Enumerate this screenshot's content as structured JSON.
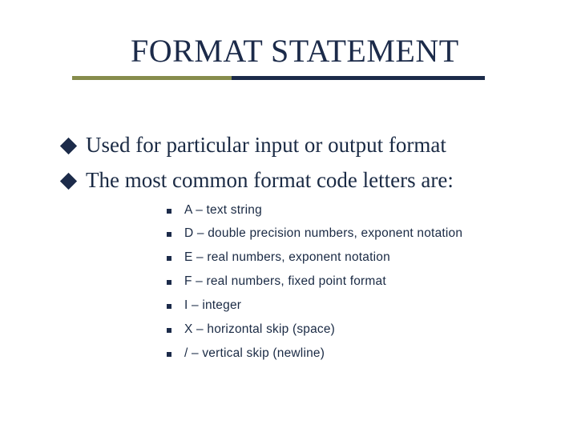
{
  "title": "FORMAT STATEMENT",
  "bullets": [
    "Used for particular input or output format",
    "The most common format code letters are:"
  ],
  "sub_items": [
    "A – text string",
    "D – double precision numbers, exponent notation",
    "E – real numbers, exponent notation",
    "F – real numbers, fixed point format",
    "I – integer",
    "X – horizontal skip (space)",
    "/ – vertical skip (newline)"
  ]
}
